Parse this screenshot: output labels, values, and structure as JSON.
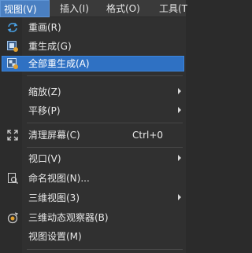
{
  "menubar": {
    "view": "视图(V)",
    "insert": "插入(I)",
    "format": "格式(O)",
    "tools": "工具(T"
  },
  "menu": {
    "redraw": "重画(R)",
    "regen": "重生成(G)",
    "regen_all": "全部重生成(A)",
    "zoom": "缩放(Z)",
    "pan": "平移(P)",
    "clean_screen": "清理屏幕(C)",
    "clean_screen_shortcut": "Ctrl+0",
    "viewports": "视口(V)",
    "named_views": "命名视图(N)...",
    "view_3d": "三维视图(3)",
    "orbit_3d": "三维动态观察器(B)",
    "view_settings": "视图设置(M)"
  },
  "colors": {
    "menubar_bg": "#3a3a3a",
    "menu_bg": "#303030",
    "highlight": "#2f71c3"
  }
}
